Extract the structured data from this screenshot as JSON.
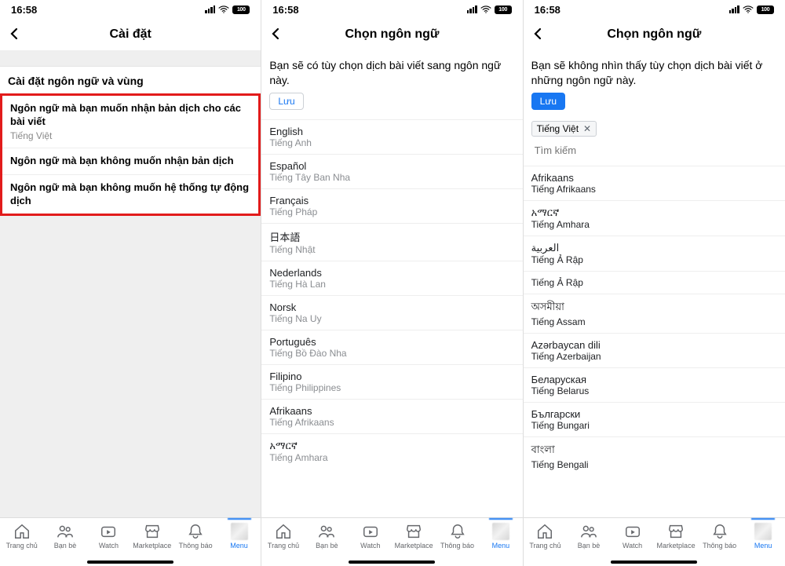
{
  "status": {
    "time": "16:58",
    "battery": "100"
  },
  "tabs": {
    "home": "Trang chủ",
    "friends": "Bạn bè",
    "watch": "Watch",
    "market": "Marketplace",
    "notif": "Thông báo",
    "menu": "Menu"
  },
  "s1": {
    "title": "Cài đặt",
    "section": "Cài đặt ngôn ngữ và vùng",
    "opts": [
      {
        "t": "Ngôn ngữ mà bạn muốn nhận bản dịch cho các bài viết",
        "s": "Tiếng Việt"
      },
      {
        "t": "Ngôn ngữ mà bạn không muốn nhận bản dịch",
        "s": ""
      },
      {
        "t": "Ngôn ngữ mà bạn không muốn hệ thống tự động dịch",
        "s": ""
      }
    ]
  },
  "s2": {
    "title": "Chọn ngôn ngữ",
    "desc": "Bạn sẽ có tùy chọn dịch bài viết sang ngôn ngữ này.",
    "save": "Lưu",
    "langs": [
      {
        "n": "English",
        "s": "Tiếng Anh"
      },
      {
        "n": "Español",
        "s": "Tiếng Tây Ban Nha"
      },
      {
        "n": "Français",
        "s": "Tiếng Pháp"
      },
      {
        "n": "日本語",
        "s": "Tiếng Nhật"
      },
      {
        "n": "Nederlands",
        "s": "Tiếng Hà Lan"
      },
      {
        "n": "Norsk",
        "s": "Tiếng Na Uy"
      },
      {
        "n": "Português",
        "s": "Tiếng Bồ Đào Nha"
      },
      {
        "n": "Filipino",
        "s": "Tiếng Philippines"
      },
      {
        "n": "Afrikaans",
        "s": "Tiếng Afrikaans"
      },
      {
        "n": "አማርኛ",
        "s": "Tiếng Amhara"
      }
    ]
  },
  "s3": {
    "title": "Chọn ngôn ngữ",
    "desc": "Bạn sẽ không nhìn thấy tùy chọn dịch bài viết ở những ngôn ngữ này.",
    "save": "Lưu",
    "chip": "Tiếng Việt",
    "search_ph": "Tìm kiếm",
    "langs": [
      {
        "n": "Afrikaans",
        "s": "Tiếng Afrikaans"
      },
      {
        "n": "አማርኛ",
        "s": "Tiếng Amhara"
      },
      {
        "n": "العربية",
        "s": "Tiếng Ả Rập"
      },
      {
        "n": "",
        "s": "Tiếng Ả Rập"
      },
      {
        "n": "অসমীয়া",
        "s": "Tiếng Assam"
      },
      {
        "n": "Azərbaycan dili",
        "s": "Tiếng Azerbaijan"
      },
      {
        "n": "Беларуская",
        "s": "Tiếng Belarus"
      },
      {
        "n": "Български",
        "s": "Tiếng Bungari"
      },
      {
        "n": "বাংলা",
        "s": "Tiếng Bengali"
      }
    ]
  }
}
